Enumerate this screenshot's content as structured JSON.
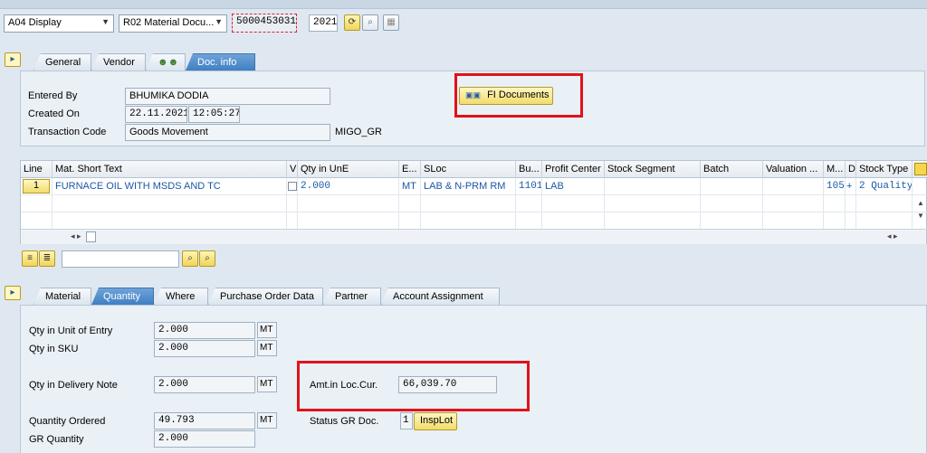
{
  "toolbar": {
    "action_value": "A04 Display",
    "ref_value": "R02 Material Docu...",
    "doc_number": "5000453031",
    "doc_year": "2021"
  },
  "header_tabs": [
    "General",
    "Vendor",
    "",
    "Doc. info"
  ],
  "doc_info": {
    "entered_by_label": "Entered By",
    "entered_by_value": "BHUMIKA DODIA",
    "created_on_label": "Created On",
    "created_on_date": "22.11.2021",
    "created_on_time": "12:05:27",
    "tcode_label": "Transaction Code",
    "tcode_value": "Goods Movement",
    "tcode_code": "MIGO_GR",
    "fi_button": "FI Documents"
  },
  "items_grid": {
    "headers": [
      "Line",
      "Mat. Short Text",
      "V",
      "Qty in UnE",
      "E...",
      "SLoc",
      "Bu...",
      "Profit Center",
      "Stock Segment",
      "Batch",
      "Valuation ...",
      "M...",
      "D",
      "Stock Type"
    ],
    "row": {
      "line": "1",
      "text": "FURNACE OIL WITH MSDS AND TC",
      "qty": "2.000",
      "unit": "MT",
      "sloc": "LAB & N-PRM RM",
      "bu": "1101",
      "pc": "LAB",
      "mvt": "105",
      "plus": "+",
      "stock_type": "2 Quality"
    }
  },
  "detail_tabs": [
    "Material",
    "Quantity",
    "Where",
    "Purchase Order Data",
    "Partner",
    "Account Assignment"
  ],
  "quantity": {
    "qty_entry_label": "Qty in Unit of Entry",
    "qty_entry_value": "2.000",
    "qty_entry_unit": "MT",
    "qty_sku_label": "Qty in SKU",
    "qty_sku_value": "2.000",
    "qty_sku_unit": "MT",
    "qty_dn_label": "Qty in Delivery Note",
    "qty_dn_value": "2.000",
    "qty_dn_unit": "MT",
    "amt_label": "Amt.in Loc.Cur.",
    "amt_value": "66,039.70",
    "qty_ordered_label": "Quantity Ordered",
    "qty_ordered_value": "49.793",
    "qty_ordered_unit": "MT",
    "status_label": "Status GR Doc.",
    "status_value": "1",
    "insp_button": "InspLot",
    "gr_qty_label": "GR Quantity",
    "gr_qty_value": "2.000"
  }
}
